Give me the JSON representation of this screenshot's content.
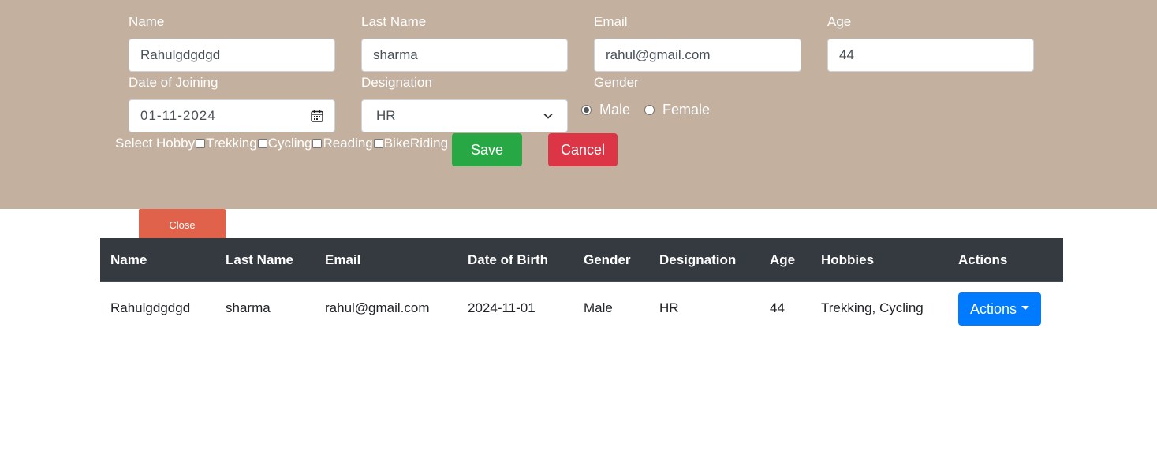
{
  "form": {
    "name_label": "Name",
    "name_value": "Rahulgdgdgd",
    "lastname_label": "Last Name",
    "lastname_value": "sharma",
    "email_label": "Email",
    "email_value": "rahul@gmail.com",
    "age_label": "Age",
    "age_value": "44",
    "doj_label": "Date of Joining",
    "doj_value": "01-11-2024",
    "designation_label": "Designation",
    "designation_value": "HR",
    "gender_label": "Gender",
    "gender_options": [
      "Male",
      "Female"
    ],
    "gender_selected": "Male",
    "hobby_label": "Select Hobby",
    "hobbies": [
      "Trekking",
      "Cycling",
      "Reading",
      "BikeRiding"
    ],
    "save_label": "Save",
    "cancel_label": "Cancel"
  },
  "close_label": "Close",
  "table": {
    "headers": [
      "Name",
      "Last Name",
      "Email",
      "Date of Birth",
      "Gender",
      "Designation",
      "Age",
      "Hobbies",
      "Actions"
    ],
    "rows": [
      {
        "name": "Rahulgdgdgd",
        "last_name": "sharma",
        "email": "rahul@gmail.com",
        "dob": "2024-11-01",
        "gender": "Male",
        "designation": "HR",
        "age": "44",
        "hobbies": "Trekking, Cycling",
        "actions_label": "Actions"
      }
    ]
  },
  "colors": {
    "form_bg": "#c4b09e",
    "save": "#28a745",
    "cancel": "#dc3545",
    "close": "#e0624b",
    "table_header": "#343a40",
    "actions": "#007bff"
  }
}
